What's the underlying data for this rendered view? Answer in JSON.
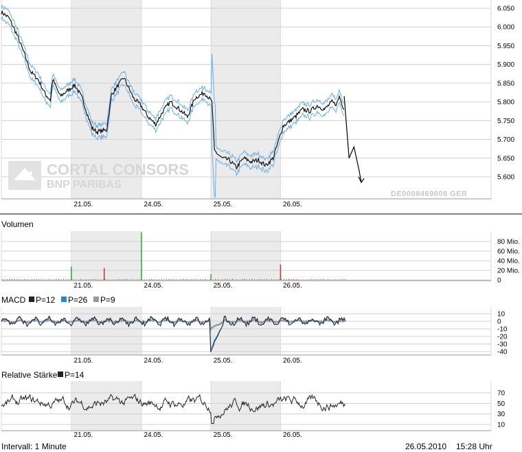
{
  "watermark": {
    "line1": "CORTAL CONSORS",
    "line2": "BNP PARIBAS"
  },
  "isin": "DE0008469008 GER",
  "footer": {
    "interval": "Intervall: 1 Minute",
    "date": "26.05.2010",
    "time": "15:28 Uhr"
  },
  "colors": {
    "price": "#111111",
    "band": "#6aaee6",
    "shade": "#ebebeb",
    "vol_up": "#2ea02e",
    "vol_down": "#d03020",
    "macd12": "#222222",
    "macd26": "#2288dd",
    "macd9": "#999999",
    "rsi": "#222222"
  },
  "chart_data": [
    {
      "type": "line",
      "name": "price",
      "x_ticks": [
        "21.05.",
        "24.05.",
        "25.05.",
        "26.05."
      ],
      "ylim": [
        5575,
        6060
      ],
      "y_ticks": [
        "6.050",
        "6.000",
        "5.950",
        "5.900",
        "5.850",
        "5.800",
        "5.750",
        "5.700",
        "5.650",
        "5.600"
      ],
      "y_tick_values": [
        6050,
        6000,
        5950,
        5900,
        5850,
        5800,
        5750,
        5700,
        5650,
        5600
      ],
      "series": [
        {
          "values": [
            6040,
            6025,
            5985,
            5935,
            5880,
            5860,
            5820,
            5805,
            5860,
            5815,
            5830,
            5845,
            5810,
            5770,
            5730,
            5720,
            5725,
            5820,
            5865,
            5810,
            5790,
            5760,
            5740,
            5775,
            5800,
            5785,
            5760,
            5810,
            5825,
            5800,
            5670,
            5650,
            5645,
            5625,
            5650,
            5640,
            5645,
            5630,
            5650,
            5735,
            5760,
            5780,
            5775,
            5790,
            5780,
            5800,
            5795,
            5795,
            5815,
            5780
          ],
          "x": [
            0,
            1.5,
            3,
            4.5,
            6,
            7.5,
            9,
            10,
            10.5,
            12,
            13.5,
            15,
            16.5,
            17.5,
            18.5,
            19.5,
            21.5,
            22.5,
            25,
            27,
            28.5,
            30,
            31.5,
            33,
            34.5,
            36,
            38,
            39.5,
            41.5,
            43,
            43.5,
            45,
            46.5,
            48,
            49.5,
            51,
            52.5,
            54,
            55.5,
            57.5,
            60,
            61.5,
            63,
            64.5,
            66,
            67.5,
            68,
            68.5,
            69,
            70
          ]
        }
      ],
      "post_trend": {
        "x": [
          70,
          71,
          72,
          73,
          73.5
        ],
        "values": [
          5815,
          5650,
          5680,
          5620,
          5585
        ]
      }
    },
    {
      "type": "bar",
      "name": "volume",
      "title": "Volumen",
      "ylim": [
        0,
        90
      ],
      "y_ticks": [
        "80 Mio.",
        "60 Mio.",
        "40 Mio.",
        "20 Mio.",
        "0"
      ],
      "y_tick_values": [
        80,
        60,
        40,
        20,
        0
      ],
      "spikes": [
        {
          "x": 14.3,
          "value": 28,
          "dir": "up"
        },
        {
          "x": 21.0,
          "value": 25,
          "dir": "down"
        },
        {
          "x": 28.6,
          "value": 99,
          "dir": "up"
        },
        {
          "x": 42.8,
          "value": 12,
          "dir": "up"
        },
        {
          "x": 57.0,
          "value": 32,
          "dir": "down"
        }
      ],
      "baseline_level": 1.5
    },
    {
      "type": "line",
      "name": "macd",
      "title": "MACD",
      "legend": [
        {
          "label": "P=12"
        },
        {
          "label": "P=26"
        },
        {
          "label": "P=9"
        }
      ],
      "ylim": [
        -43,
        18
      ],
      "y_ticks": [
        "10",
        "0",
        "-10",
        "-20",
        "-30",
        "-40"
      ],
      "y_tick_values": [
        10,
        0,
        -10,
        -20,
        -30,
        -40
      ],
      "features": [
        {
          "x": 43.0,
          "value": -40
        },
        {
          "x": 43.6,
          "value": -20
        },
        {
          "x": 45.0,
          "value": -10
        }
      ]
    },
    {
      "type": "line",
      "name": "rsi",
      "title": "Relative Stärke",
      "legend": [
        {
          "label": "P=14"
        }
      ],
      "ylim": [
        0,
        100
      ],
      "y_ticks": [
        "70",
        "50",
        "30",
        "10"
      ],
      "y_tick_values": [
        70,
        50,
        30,
        10
      ]
    }
  ]
}
